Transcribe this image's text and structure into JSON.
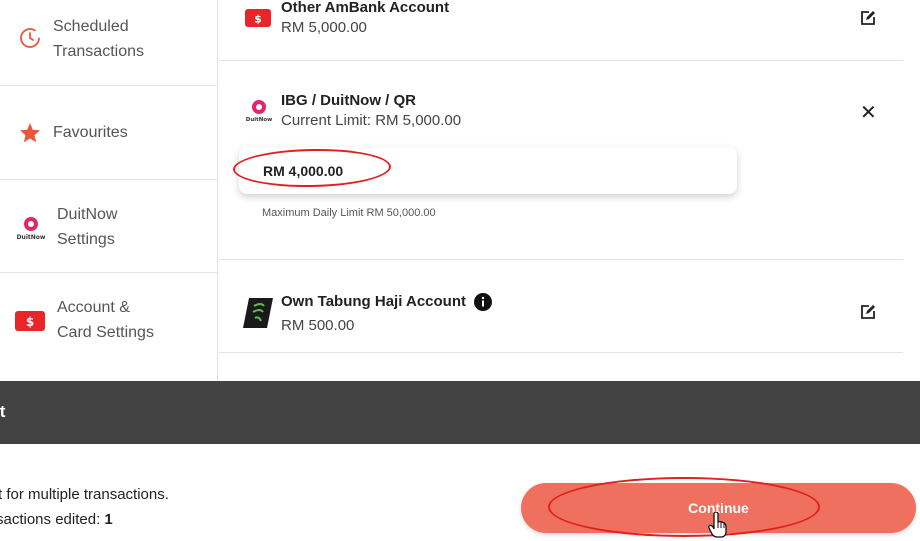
{
  "sidebar": {
    "items": [
      {
        "label": "Scheduled Transactions",
        "line1": "Scheduled",
        "line2": "Transactions",
        "icon": "clock-icon"
      },
      {
        "label": "Favourites",
        "icon": "star-icon"
      },
      {
        "label": "DuitNow Settings",
        "line1": "DuitNow",
        "line2": "Settings",
        "icon": "duitnow-logo-icon"
      },
      {
        "label": "Account & Card Settings",
        "line1": "Account &",
        "line2": "Card Settings",
        "icon": "dollar-card-icon"
      }
    ]
  },
  "accounts": {
    "other_ambank": {
      "name": "Other AmBank Account",
      "value": "RM 5,000.00"
    },
    "ibg": {
      "name": "IBG / DuitNow / QR",
      "current_limit": "Current Limit: RM 5,000.00",
      "input_value": "RM 4,000.00",
      "hint": "Maximum Daily Limit RM 50,000.00"
    },
    "tabung_haji": {
      "name": "Own Tabung Haji Account",
      "value": "RM 500.00"
    }
  },
  "panel": {
    "title": "it",
    "description": "t for multiple transactions.",
    "edited_label": "sactions edited: ",
    "edited_count": "1",
    "continue_label": "Continue"
  },
  "colors": {
    "accent": "#f07060",
    "brand_red": "#e8262a",
    "annotation": "#e02020",
    "header_dark": "#424242"
  }
}
